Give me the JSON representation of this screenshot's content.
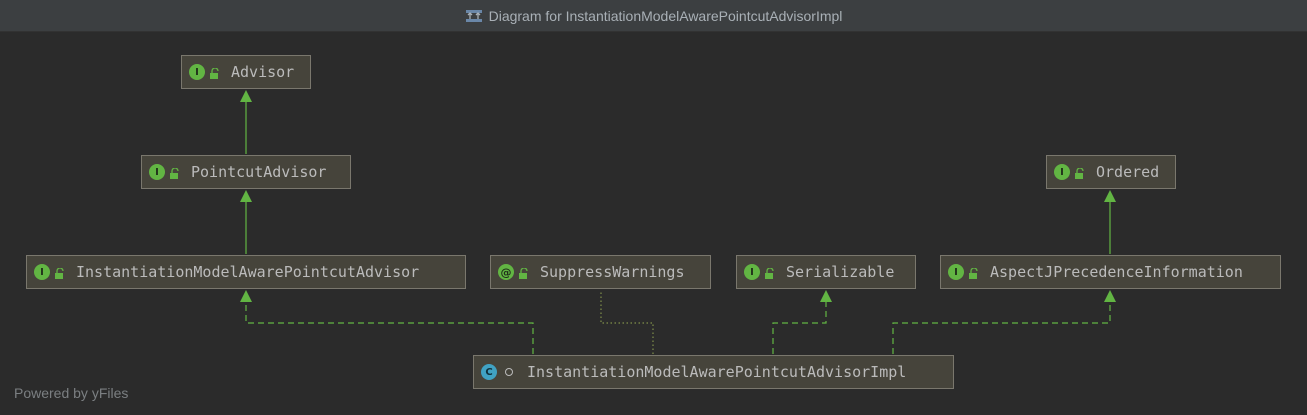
{
  "window": {
    "title": "Diagram for InstantiationModelAwarePointcutAdvisorImpl"
  },
  "nodes": {
    "advisor": {
      "label": "Advisor",
      "kind": "interface"
    },
    "pointcut_advisor": {
      "label": "PointcutAdvisor",
      "kind": "interface"
    },
    "imapa": {
      "label": "InstantiationModelAwarePointcutAdvisor",
      "kind": "interface"
    },
    "suppress_warnings": {
      "label": "SuppressWarnings",
      "kind": "annotation"
    },
    "serializable": {
      "label": "Serializable",
      "kind": "interface"
    },
    "aspectj_precedence": {
      "label": "AspectJPrecedenceInformation",
      "kind": "interface"
    },
    "ordered": {
      "label": "Ordered",
      "kind": "interface"
    },
    "impl": {
      "label": "InstantiationModelAwarePointcutAdvisorImpl",
      "kind": "class"
    }
  },
  "badges": {
    "interface": "I",
    "annotation": "@",
    "class": "C"
  },
  "colors": {
    "background": "#2b2b2b",
    "node_fill": "#46443b",
    "node_border": "#7a776d",
    "edge": "#62b543",
    "interface_badge": "#62b543",
    "class_badge": "#40a2c3"
  },
  "footer": {
    "text": "Powered by yFiles"
  }
}
